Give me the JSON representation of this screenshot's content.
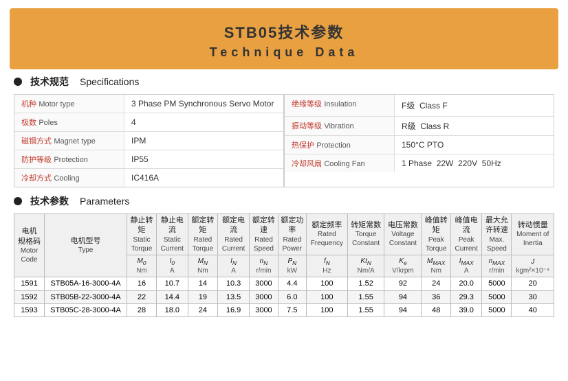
{
  "header": {
    "title_cn": "STB05技术参数",
    "title_en": "Technique Data"
  },
  "specs_section": {
    "bullet": true,
    "label_cn": "技术规范",
    "label_en": "Specifications",
    "left_rows": [
      {
        "label_cn": "机种",
        "label_en": "Motor type",
        "value": "3 Phase PM Synchronous Servo Motor"
      },
      {
        "label_cn": "极数",
        "label_en": "Poles",
        "value": "4"
      },
      {
        "label_cn": "磁钢方式",
        "label_en": "Magnet type",
        "value": "IPM"
      },
      {
        "label_cn": "防护等级",
        "label_en": "Protection",
        "value": "IP55"
      },
      {
        "label_cn": "冷却方式",
        "label_en": "Cooling",
        "value": "IC416A"
      }
    ],
    "right_rows": [
      {
        "label_cn": "绝缘等级",
        "label_en": "Insulation",
        "value": "F级  Class F"
      },
      {
        "label_cn": "振动等级",
        "label_en": "Vibration",
        "value": "R级  Class R"
      },
      {
        "label_cn": "热保护",
        "label_en": "Protection",
        "value": "150°C PTO"
      },
      {
        "label_cn": "冷却风扇",
        "label_en": "Cooling Fan",
        "value": "1 Phase  22W  220V  50Hz"
      }
    ]
  },
  "params_section": {
    "bullet": true,
    "label_cn": "技术参数",
    "label_en": "Parameters",
    "col_headers": [
      {
        "cn": "电机规格码",
        "en": "Motor Code",
        "sym": "",
        "unit": ""
      },
      {
        "cn": "电机型号",
        "en": "Type",
        "sym": "",
        "unit": ""
      },
      {
        "cn": "静止转矩",
        "en": "Static Torque",
        "sym": "M₀",
        "unit": "Nm"
      },
      {
        "cn": "静止电流",
        "en": "Static Current",
        "sym": "I₀",
        "unit": "A"
      },
      {
        "cn": "额定转矩",
        "en": "Rated Torque",
        "sym": "M_N",
        "unit": "Nm"
      },
      {
        "cn": "额定电流",
        "en": "Rated Current",
        "sym": "I_N",
        "unit": "A"
      },
      {
        "cn": "额定转速",
        "en": "Rated Speed",
        "sym": "n_N",
        "unit": "r/min"
      },
      {
        "cn": "额定功率",
        "en": "Rated Power",
        "sym": "P_N",
        "unit": "kW"
      },
      {
        "cn": "额定频率",
        "en": "Rated Frequency",
        "sym": "f_N",
        "unit": "Hz"
      },
      {
        "cn": "转矩常数",
        "en": "Torque Constant",
        "sym": "Kt_N",
        "unit": "Nm/A"
      },
      {
        "cn": "电压常数",
        "en": "Voltage Constant",
        "sym": "Ke",
        "unit": "V/krpm"
      },
      {
        "cn": "峰值转矩",
        "en": "Peak Torque",
        "sym": "M_MAX",
        "unit": "Nm"
      },
      {
        "cn": "峰值电流",
        "en": "Peak Current",
        "sym": "I_MAX",
        "unit": "A"
      },
      {
        "cn": "最大允许转速",
        "en": "Max. Speed",
        "sym": "n_MAX",
        "unit": "r/min"
      },
      {
        "cn": "转动惯量",
        "en": "Moment of Inertia",
        "sym": "J",
        "unit": "kgm²×10⁻⁴"
      }
    ],
    "rows": [
      {
        "code": "1591",
        "type": "STB05A-16-3000-4A",
        "vals": [
          "16",
          "10.7",
          "14",
          "10.3",
          "3000",
          "4.4",
          "100",
          "1.52",
          "92",
          "24",
          "20.0",
          "5000",
          "20"
        ]
      },
      {
        "code": "1592",
        "type": "STB05B-22-3000-4A",
        "vals": [
          "22",
          "14.4",
          "19",
          "13.5",
          "3000",
          "6.0",
          "100",
          "1.55",
          "94",
          "36",
          "29.3",
          "5000",
          "30"
        ]
      },
      {
        "code": "1593",
        "type": "STB05C-28-3000-4A",
        "vals": [
          "28",
          "18.0",
          "24",
          "16.9",
          "3000",
          "7.5",
          "100",
          "1.55",
          "94",
          "48",
          "39.0",
          "5000",
          "40"
        ]
      }
    ]
  }
}
